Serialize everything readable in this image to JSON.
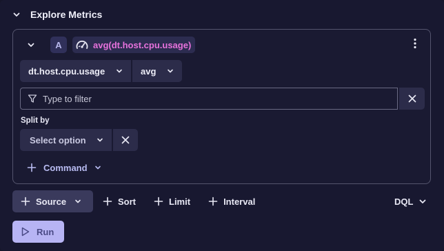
{
  "header": {
    "title": "Explore Metrics",
    "collapse_icon": "chevron-down-icon"
  },
  "query": {
    "badge": "A",
    "metric_icon": "gauge-icon",
    "expression": "avg(dt.host.cpu.usage)",
    "menu_icon": "kebab-menu-icon",
    "metric_select": "dt.host.cpu.usage",
    "aggregation_select": "avg",
    "filter": {
      "placeholder": "Type to filter",
      "value": ""
    },
    "split_by": {
      "label": "Split by",
      "placeholder": "Select option"
    },
    "command_label": "Command"
  },
  "toolbar": {
    "source_label": "Source",
    "sort_label": "Sort",
    "limit_label": "Limit",
    "interval_label": "Interval",
    "dql_label": "DQL"
  },
  "run": {
    "label": "Run"
  },
  "colors": {
    "background": "#181830",
    "accent_pink": "#e772dc",
    "run_button": "#b7b4f4",
    "command_text": "#b9bcf2"
  }
}
